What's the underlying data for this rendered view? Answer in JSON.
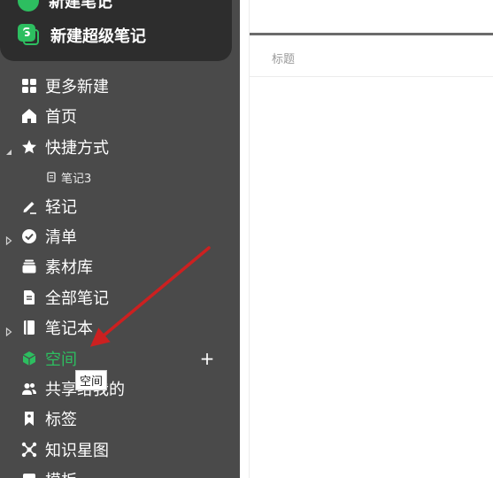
{
  "top": {
    "new_note_label": "新建笔记",
    "new_super_note_label": "新建超级笔记",
    "super_note_icon_letter": "S"
  },
  "sidebar": {
    "items": [
      {
        "label": "更多新建",
        "icon": "grid-icon"
      },
      {
        "label": "首页",
        "icon": "home-icon"
      },
      {
        "label": "快捷方式",
        "icon": "star-icon",
        "expanded": true
      },
      {
        "label": "笔记3",
        "icon": "note-icon"
      },
      {
        "label": "轻记",
        "icon": "pen-icon"
      },
      {
        "label": "清单",
        "icon": "check-circle-icon",
        "expanded": false
      },
      {
        "label": "素材库",
        "icon": "stack-icon"
      },
      {
        "label": "全部笔记",
        "icon": "document-icon"
      },
      {
        "label": "笔记本",
        "icon": "notebook-icon",
        "expanded": false
      },
      {
        "label": "空间",
        "icon": "cube-icon",
        "active": true
      },
      {
        "label": "共享给我的",
        "icon": "people-icon"
      },
      {
        "label": "标签",
        "icon": "tag-icon"
      },
      {
        "label": "知识星图",
        "icon": "network-icon"
      },
      {
        "label": "模板",
        "icon": "template-icon"
      }
    ],
    "space_add": "+",
    "tooltip": "空间"
  },
  "editor": {
    "title_placeholder": "标题"
  },
  "colors": {
    "sidebar_bg": "#4a4a4a",
    "top_card_bg": "#2d2d2d",
    "accent_green": "#2dbe60",
    "annotation_arrow": "#cc2020"
  }
}
